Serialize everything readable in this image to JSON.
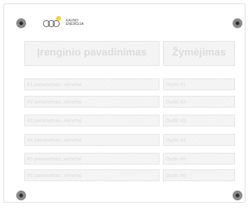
{
  "logo": {
    "line1": "KAUNO",
    "line2": "ENERGIJA",
    "dot_color": "#f3d23a"
  },
  "header": {
    "device_name": "Įrenginio pavadinimas",
    "marking": "Žymėjimas"
  },
  "params": [
    {
      "label": "#1 parametras, vienetai",
      "value": "Dydis #1"
    },
    {
      "label": "#2 parametras, vienetai",
      "value": "Dydis #2"
    },
    {
      "label": "#3 parametras, vienetai",
      "value": "Dydis #3"
    },
    {
      "label": "#4 parametras, vienetai",
      "value": "Dydis #4"
    },
    {
      "label": "#5 parametras, vienetai",
      "value": "Dydis #5"
    },
    {
      "label": "#6 parametras, vienetai",
      "value": "Dydis #6"
    }
  ]
}
